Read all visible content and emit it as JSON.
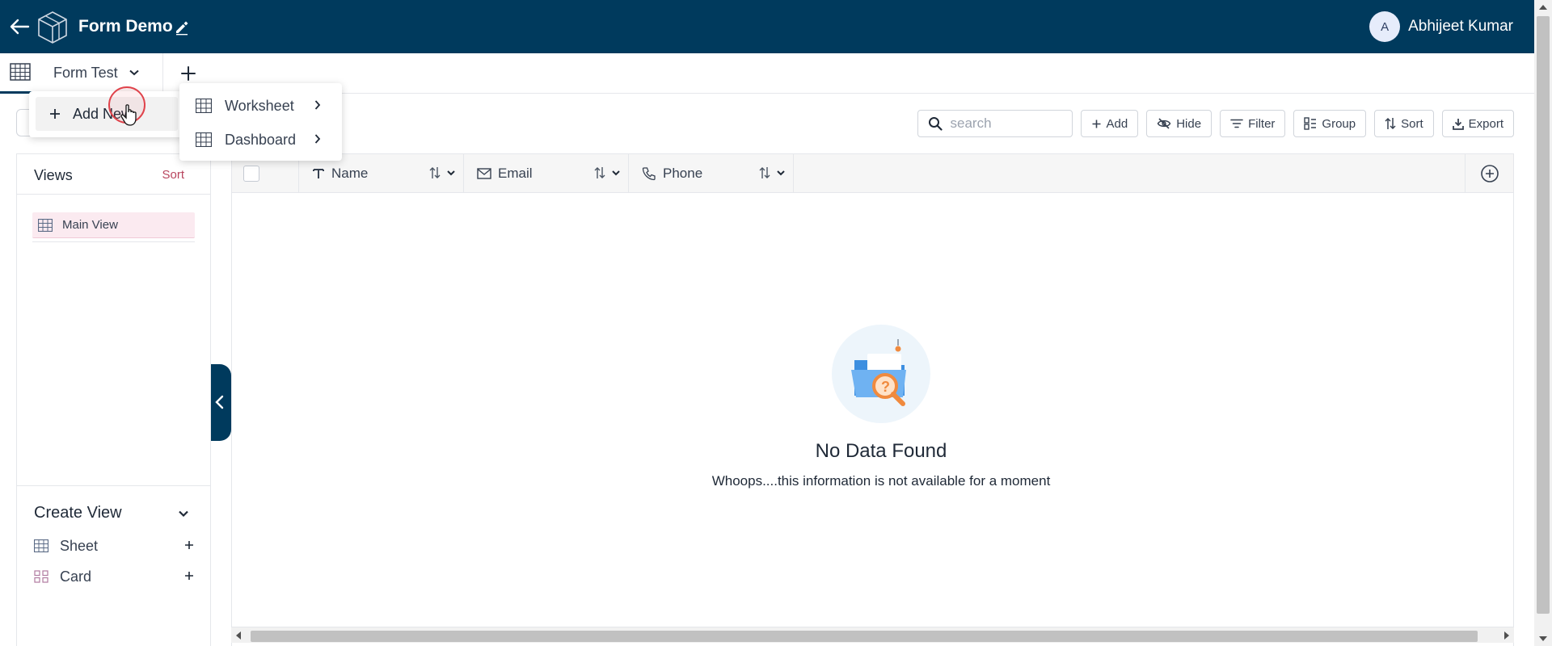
{
  "header": {
    "app_title": "Form Demo",
    "user": {
      "initial": "A",
      "name": "Abhijeet Kumar"
    },
    "bg_color": "#003a5d"
  },
  "tabs": {
    "active_label": "Form Test"
  },
  "add_menu": {
    "item_label": "Add New",
    "submenu": [
      {
        "label": "Worksheet",
        "icon": "grid-icon"
      },
      {
        "label": "Dashboard",
        "icon": "grid-icon"
      }
    ]
  },
  "sidebar": {
    "views_title": "Views",
    "sort_label": "Sort",
    "views": [
      {
        "label": "Main View",
        "icon": "grid-icon"
      }
    ],
    "create_view": {
      "title": "Create View",
      "items": [
        {
          "label": "Sheet",
          "icon": "grid-icon"
        },
        {
          "label": "Card",
          "icon": "card-icon"
        }
      ]
    }
  },
  "toolbar": {
    "search_placeholder": "search",
    "buttons": [
      {
        "label": "Add",
        "icon": "plus-icon"
      },
      {
        "label": "Hide",
        "icon": "eye-off-icon"
      },
      {
        "label": "Filter",
        "icon": "filter-icon"
      },
      {
        "label": "Group",
        "icon": "group-icon"
      },
      {
        "label": "Sort",
        "icon": "sort-icon"
      },
      {
        "label": "Export",
        "icon": "download-icon"
      }
    ]
  },
  "table": {
    "columns": [
      {
        "label": "Name",
        "icon": "text-icon"
      },
      {
        "label": "Email",
        "icon": "mail-icon"
      },
      {
        "label": "Phone",
        "icon": "phone-icon"
      }
    ]
  },
  "empty_state": {
    "title": "No Data Found",
    "message": "Whoops....this information is not available for a moment"
  },
  "colors": {
    "brand": "#003a5d",
    "accent_pink": "#b8445d",
    "selected_view_bg": "#fbeaf0"
  }
}
